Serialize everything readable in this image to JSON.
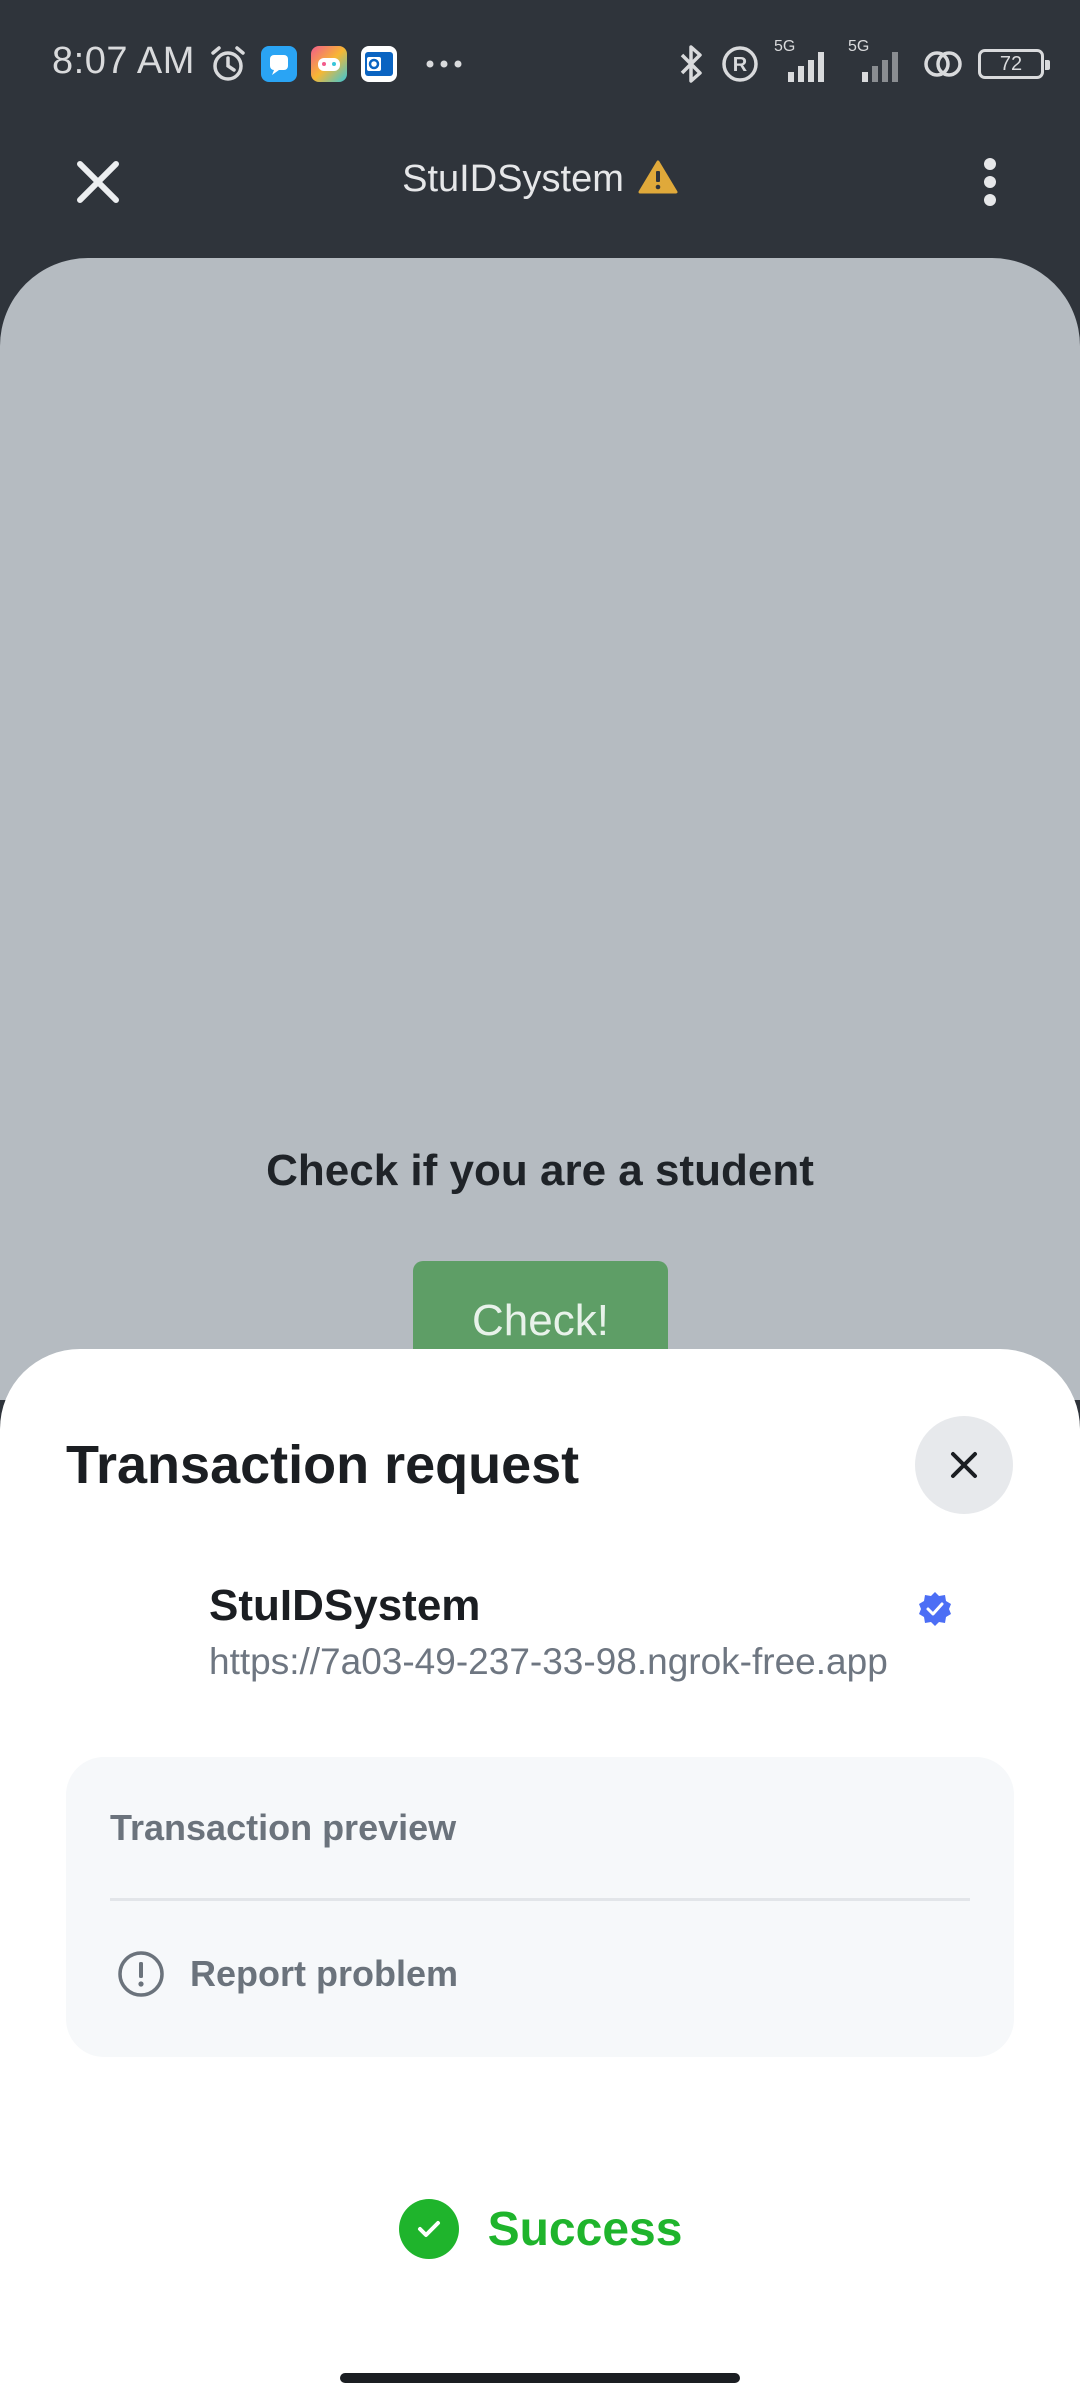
{
  "status_bar": {
    "time": "8:07 AM",
    "battery": "72",
    "signal_1_label": "5G",
    "signal_2_label": "5G",
    "icons": [
      "alarm-icon",
      "messages-app-icon",
      "game-app-icon",
      "outlook-app-icon",
      "more-notifications-icon",
      "bluetooth-icon",
      "registered-icon",
      "signal-icon",
      "signal-icon",
      "link-icon",
      "battery-icon"
    ]
  },
  "appbar": {
    "title": "StuIDSystem",
    "close_icon": "close-icon",
    "warning_icon": "warning-icon",
    "menu_icon": "more-vertical-icon"
  },
  "webview": {
    "heading": "Check if you are a student",
    "check_button": "Check!",
    "background": "#b5bbc1",
    "button_color": "#5e9e66"
  },
  "sheet": {
    "title": "Transaction request",
    "close_icon": "close-icon",
    "dapp_name": "StuIDSystem",
    "dapp_url": "https://7a03-49-237-33-98.ngrok-free.app",
    "verified_icon": "verified-badge-icon",
    "preview_label": "Transaction preview",
    "report_label": "Report problem",
    "report_icon": "alert-circle-icon",
    "status": "Success",
    "status_icon": "check-circle-icon",
    "status_color": "#1fb42c",
    "verified_color": "#4c6ef5"
  }
}
